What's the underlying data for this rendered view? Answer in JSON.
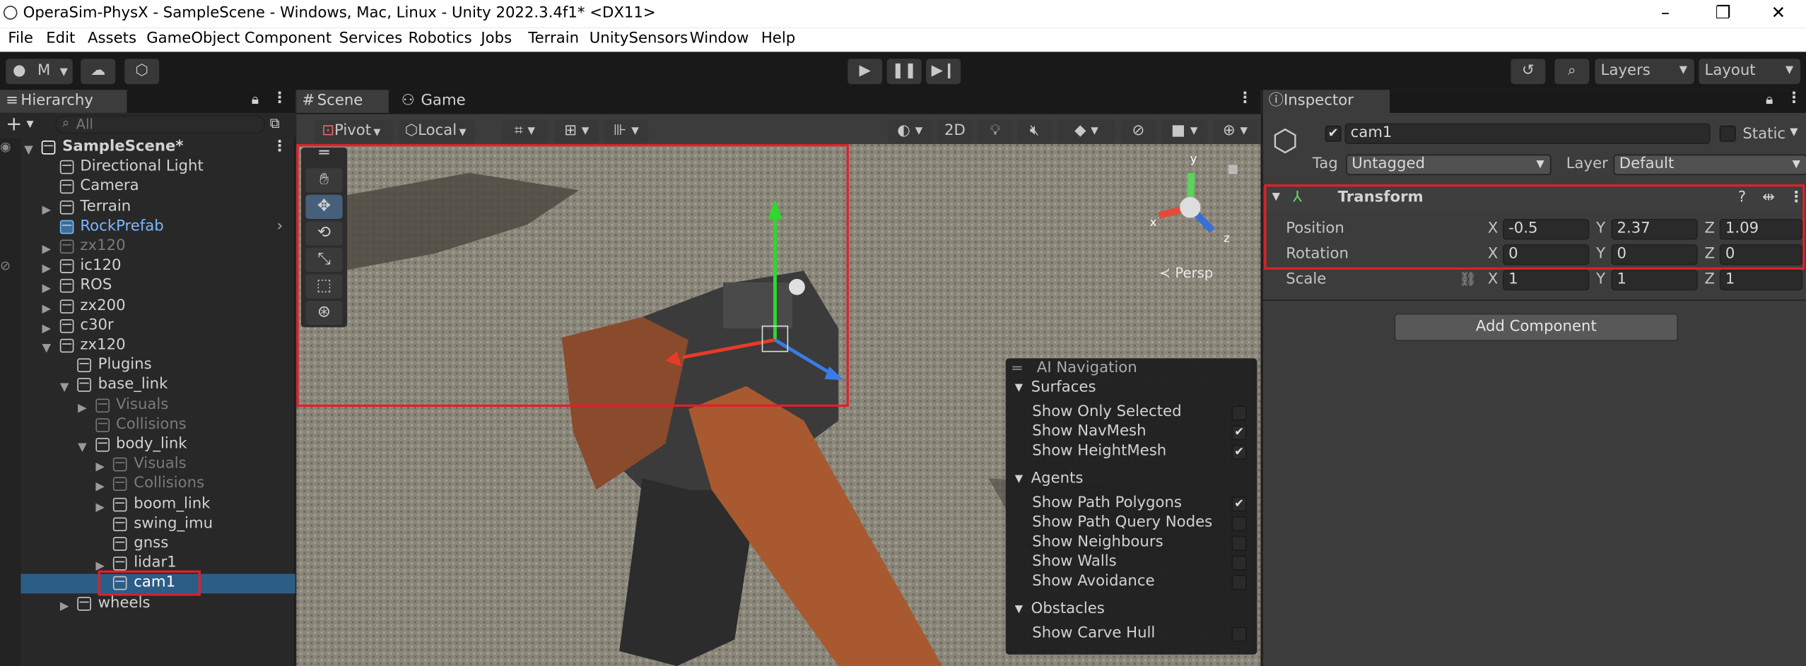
{
  "window": {
    "title": "OperaSim-PhysX - SampleScene - Windows, Mac, Linux - Unity 2022.3.4f1* <DX11>"
  },
  "menu": [
    "File",
    "Edit",
    "Assets",
    "GameObject",
    "Component",
    "Services",
    "Robotics",
    "Jobs",
    "Terrain",
    "UnitySensors",
    "Window",
    "Help"
  ],
  "toolbar": {
    "account": "M",
    "layers": "Layers",
    "layout": "Layout"
  },
  "hierarchy": {
    "tab": "Hierarchy",
    "search_placeholder": "All",
    "items": [
      {
        "label": "SampleScene*",
        "depth": 0,
        "state": "scene"
      },
      {
        "label": "Directional Light",
        "depth": 1,
        "state": "normal"
      },
      {
        "label": "Camera",
        "depth": 1,
        "state": "normal"
      },
      {
        "label": "Terrain",
        "depth": 1,
        "state": "normal"
      },
      {
        "label": "RockPrefab",
        "depth": 1,
        "state": "prefab"
      },
      {
        "label": "zx120",
        "depth": 1,
        "state": "dim"
      },
      {
        "label": "ic120",
        "depth": 1,
        "state": "normal"
      },
      {
        "label": "ROS",
        "depth": 1,
        "state": "normal"
      },
      {
        "label": "zx200",
        "depth": 1,
        "state": "normal"
      },
      {
        "label": "c30r",
        "depth": 1,
        "state": "normal"
      },
      {
        "label": "zx120",
        "depth": 1,
        "state": "normal"
      },
      {
        "label": "Plugins",
        "depth": 2,
        "state": "normal"
      },
      {
        "label": "base_link",
        "depth": 2,
        "state": "normal"
      },
      {
        "label": "Visuals",
        "depth": 3,
        "state": "dim"
      },
      {
        "label": "Collisions",
        "depth": 3,
        "state": "dim"
      },
      {
        "label": "body_link",
        "depth": 3,
        "state": "normal"
      },
      {
        "label": "Visuals",
        "depth": 4,
        "state": "dim"
      },
      {
        "label": "Collisions",
        "depth": 4,
        "state": "dim"
      },
      {
        "label": "boom_link",
        "depth": 4,
        "state": "normal"
      },
      {
        "label": "swing_imu",
        "depth": 4,
        "state": "normal"
      },
      {
        "label": "gnss",
        "depth": 4,
        "state": "normal"
      },
      {
        "label": "lidar1",
        "depth": 4,
        "state": "normal"
      },
      {
        "label": "cam1",
        "depth": 4,
        "state": "selected"
      },
      {
        "label": "wheels",
        "depth": 2,
        "state": "normal"
      }
    ]
  },
  "scene": {
    "tabs": [
      "Scene",
      "Game"
    ],
    "pivot": "Pivot",
    "local": "Local",
    "mode_2d": "2D",
    "persp": "Persp",
    "gizmo_axes": {
      "y": "y",
      "x": "x",
      "z": "z"
    }
  },
  "ai_navigation": {
    "title": "AI Navigation",
    "surfaces": "Surfaces",
    "surface_items": [
      {
        "label": "Show Only Selected",
        "checked": false
      },
      {
        "label": "Show NavMesh",
        "checked": true
      },
      {
        "label": "Show HeightMesh",
        "checked": true
      }
    ],
    "agents": "Agents",
    "agent_items": [
      {
        "label": "Show Path Polygons",
        "checked": true
      },
      {
        "label": "Show Path Query Nodes",
        "checked": false
      },
      {
        "label": "Show Neighbours",
        "checked": false
      },
      {
        "label": "Show Walls",
        "checked": false
      },
      {
        "label": "Show Avoidance",
        "checked": false
      }
    ],
    "obstacles": "Obstacles",
    "obstacle_items": [
      {
        "label": "Show Carve Hull",
        "checked": false
      }
    ]
  },
  "inspector": {
    "tab": "Inspector",
    "object_name": "cam1",
    "static_label": "Static",
    "tag_label": "Tag",
    "tag_value": "Untagged",
    "layer_label": "Layer",
    "layer_value": "Default",
    "component": "Transform",
    "position": {
      "label": "Position",
      "x": "-0.5",
      "y": "2.37",
      "z": "1.09"
    },
    "rotation": {
      "label": "Rotation",
      "x": "0",
      "y": "0",
      "z": "0"
    },
    "scale": {
      "label": "Scale",
      "x": "1",
      "y": "1",
      "z": "1"
    },
    "axis": {
      "x": "X",
      "y": "Y",
      "z": "Z"
    },
    "add_component": "Add Component"
  }
}
